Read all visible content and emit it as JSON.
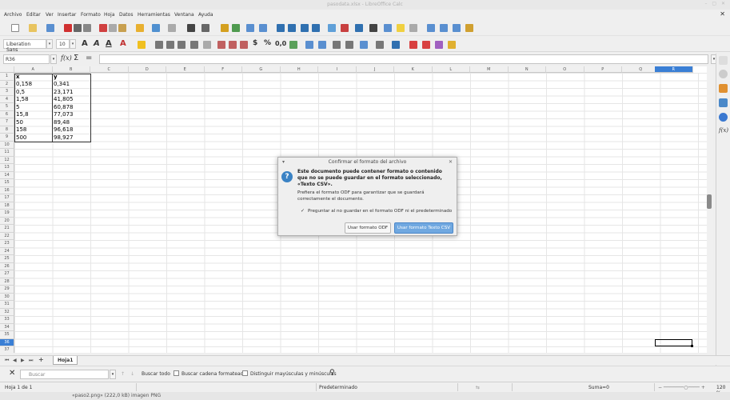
{
  "window": {
    "title": "pasodata.xlsx - LibreOffice Calc"
  },
  "menu": [
    "Archivo",
    "Editar",
    "Ver",
    "Insertar",
    "Formato",
    "Hoja",
    "Datos",
    "Herramientas",
    "Ventana",
    "Ayuda"
  ],
  "formatting": {
    "font_name": "Liberation Sans",
    "font_size": "10"
  },
  "formula_bar": {
    "cell_ref": "R36",
    "content": ""
  },
  "columns": [
    "A",
    "B",
    "C",
    "D",
    "E",
    "F",
    "G",
    "H",
    "I",
    "J",
    "K",
    "L",
    "M",
    "N",
    "O",
    "P",
    "Q",
    "R"
  ],
  "selected_column": "R",
  "selected_row": "36",
  "rows": [
    "1",
    "2",
    "3",
    "4",
    "5",
    "6",
    "7",
    "8",
    "9",
    "10",
    "11",
    "12",
    "13",
    "14",
    "15",
    "16",
    "17",
    "18",
    "19",
    "20",
    "21",
    "22",
    "23",
    "24",
    "25",
    "26",
    "27",
    "28",
    "29",
    "30",
    "31",
    "32",
    "33",
    "34",
    "35",
    "36",
    "37"
  ],
  "cells": {
    "header": {
      "a": "x",
      "b": "y"
    },
    "data": [
      {
        "a": "0,158",
        "b": "0,341"
      },
      {
        "a": "0,5",
        "b": "23,171"
      },
      {
        "a": "1,58",
        "b": "41,805"
      },
      {
        "a": "5",
        "b": "60,878"
      },
      {
        "a": "15,8",
        "b": "77,073"
      },
      {
        "a": "50",
        "b": "89,48"
      },
      {
        "a": "158",
        "b": "96,618"
      },
      {
        "a": "500",
        "b": "98,927"
      }
    ]
  },
  "dialog": {
    "title": "Confirmar el formato del archivo",
    "heading": "Este documento puede contener formato o contenido que no se puede guardar en el formato seleccionado, «Texto CSV».",
    "body": "Prefiera el formato ODF para garantizar que se guardará correctamente el documento.",
    "checkbox_label": "Preguntar al no guardar en el formato ODF ni el predeterminado",
    "checkbox_checked": true,
    "btn_odf": "Usar formato ODF",
    "btn_csv": "Usar formato Texto CSV"
  },
  "sheet_tabs": {
    "active": "Hoja1"
  },
  "find_bar": {
    "placeholder": "Buscar",
    "find_all": "Buscar todo",
    "formatted": "Buscar cadena formateada",
    "match_case": "Distinguir mayúsculas y minúsculas"
  },
  "status": {
    "sheet": "Hoja 1 de 1",
    "style": "Predeterminado",
    "sum": "Suma=0",
    "zoom": "120 %"
  },
  "tooltip": "«paso2.png» (222,0 kB) imagen PNG"
}
